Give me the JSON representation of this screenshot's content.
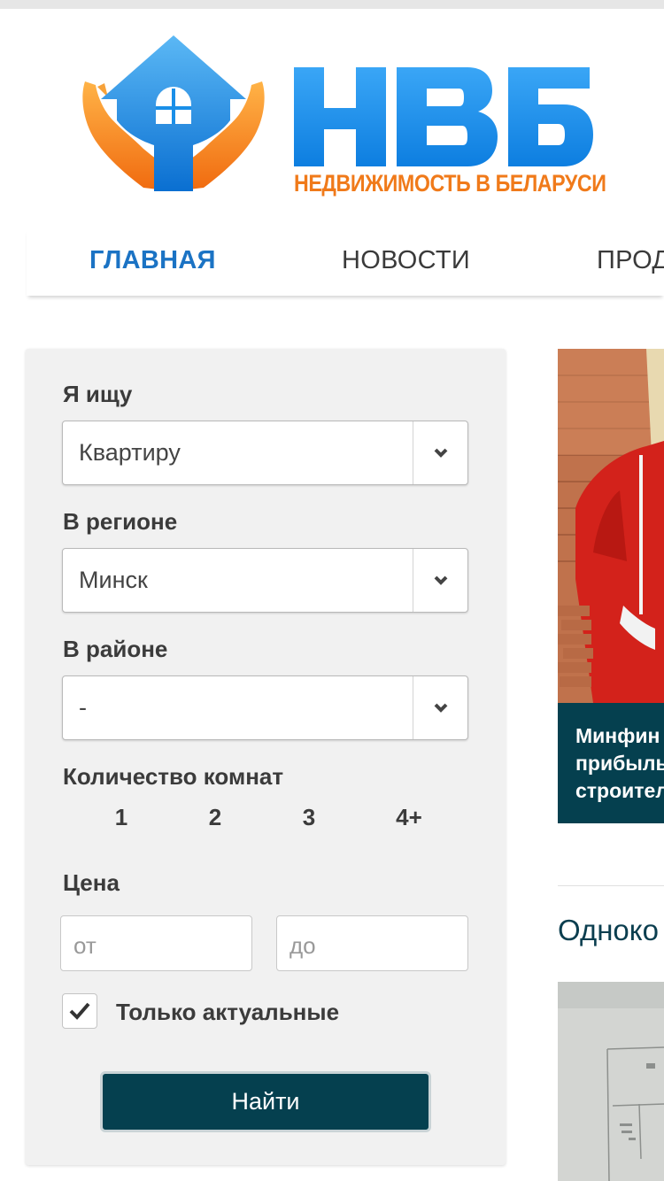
{
  "logo": {
    "letters": "НВБ",
    "tagline": "НЕДВИЖИМОСТЬ В БЕЛАРУСИ",
    "colors": {
      "blue": "#1a8fe8",
      "orange": "#f07a1a"
    }
  },
  "nav": {
    "items": [
      {
        "label": "ГЛАВНАЯ",
        "active": true
      },
      {
        "label": "НОВОСТИ",
        "active": false
      },
      {
        "label": "ПРОД",
        "active": false
      }
    ]
  },
  "search": {
    "looking_for_label": "Я ищу",
    "looking_for_value": "Квартиру",
    "region_label": "В регионе",
    "region_value": "Минск",
    "district_label": "В районе",
    "district_value": "-",
    "rooms_label": "Количество комнат",
    "rooms": [
      "1",
      "2",
      "3",
      "4+"
    ],
    "price_label": "Цена",
    "price_from_placeholder": "от",
    "price_to_placeholder": "до",
    "only_actual_label": "Только актуальные",
    "only_actual_checked": true,
    "submit_label": "Найти"
  },
  "news": {
    "caption_lines": [
      "Минфин",
      "прибыль",
      "строител"
    ]
  },
  "listing": {
    "section_title": "Одноко"
  },
  "colors": {
    "accent_dark": "#05404f",
    "nav_active": "#1b73c4",
    "panel_bg": "#f1f1f1"
  }
}
